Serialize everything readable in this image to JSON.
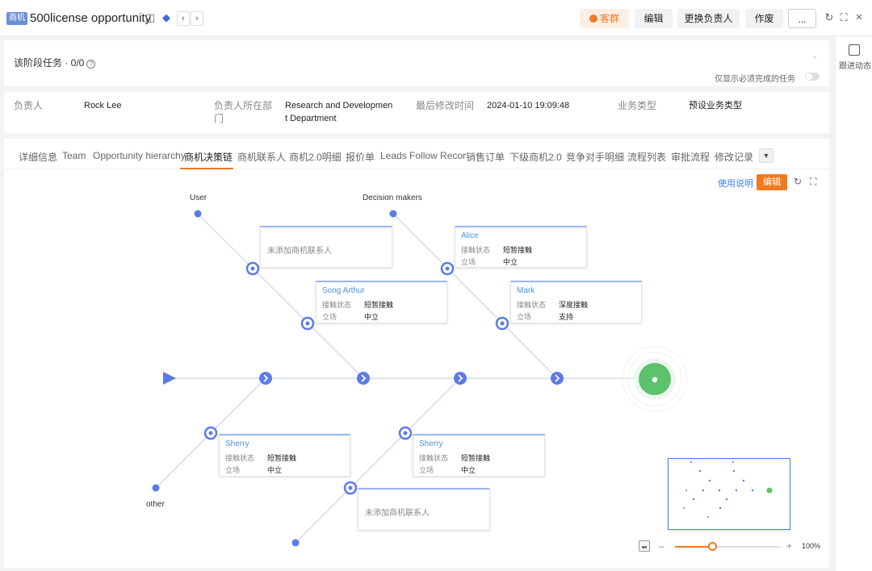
{
  "header": {
    "badge": "商机",
    "title": "500license opportunity",
    "buttons": {
      "kequn": "客群",
      "edit": "编辑",
      "change_owner": "更换负责人",
      "void": "作废",
      "more": "..."
    }
  },
  "sidebar": {
    "follow_label": "跟进动态"
  },
  "tasks": {
    "title": "该阶段任务 · 0/0",
    "filter_label": "仅显示必须完成的任务"
  },
  "info": {
    "owner_label": "负责人",
    "owner_value": "Rock Lee",
    "dept_label_1": "负责人所在部",
    "dept_label_2": "门",
    "dept_value_1": "Research and Developmen",
    "dept_value_2": "t Department",
    "modified_label": "最后修改时间",
    "modified_value": "2024-01-10 19:09:48",
    "biztype_label": "业务类型",
    "biztype_value": "预设业务类型"
  },
  "tabs": [
    "详细信息",
    "Team",
    "Opportunity hierarchy",
    "商机决策链",
    "商机联系人",
    "商机2.0明细",
    "报价单",
    "Leads Follow Recor",
    "销售订单",
    "下级商机2.0",
    "竞争对手明细",
    "流程列表",
    "审批流程",
    "修改记录"
  ],
  "active_tab": "商机决策链",
  "toolbar": {
    "usage": "使用说明",
    "edit": "编辑"
  },
  "diagram": {
    "label_user": "User",
    "label_decision": "Decision makers",
    "label_other": "other",
    "empty_text": "未添加商机联系人",
    "key_status": "接触状态",
    "key_stance": "立场",
    "contacts": [
      {
        "name": "Alice",
        "status": "短暂接触",
        "stance": "中立"
      },
      {
        "name": "Song Arthur",
        "status": "短暂接触",
        "stance": "中立"
      },
      {
        "name": "Mark",
        "status": "深度接触",
        "stance": "支持"
      },
      {
        "name": "Sherry",
        "status": "短暂接触",
        "stance": "中立"
      },
      {
        "name": "Sherry",
        "status": "短暂接触",
        "stance": "中立"
      }
    ],
    "colors": {
      "node": "#5b7be8",
      "goal": "#5cc26b",
      "card_border": "#9bb6f0",
      "accent": "#f07a22"
    }
  },
  "zoom": {
    "value": "100%",
    "level": 0.35
  }
}
